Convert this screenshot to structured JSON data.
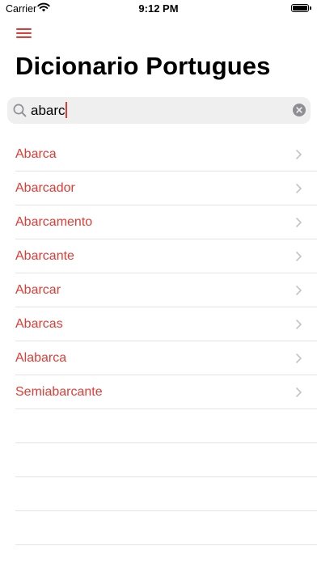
{
  "status_bar": {
    "carrier": "Carrier",
    "time": "9:12 PM"
  },
  "header": {
    "title": "Dicionario Portugues"
  },
  "search": {
    "value": "abarc"
  },
  "results": [
    "Abarca",
    "Abarcador",
    "Abarcamento",
    "Abarcante",
    "Abarcar",
    "Abarcas",
    "Alabarca",
    "Semiabarcante"
  ],
  "colors": {
    "accent": "#e33b34",
    "separator": "#e3e3e5",
    "search_bg": "#efeff0"
  },
  "icons": [
    "wifi-icon",
    "battery-icon",
    "menu-icon",
    "search-icon",
    "clear-icon",
    "chevron-right-icon"
  ]
}
